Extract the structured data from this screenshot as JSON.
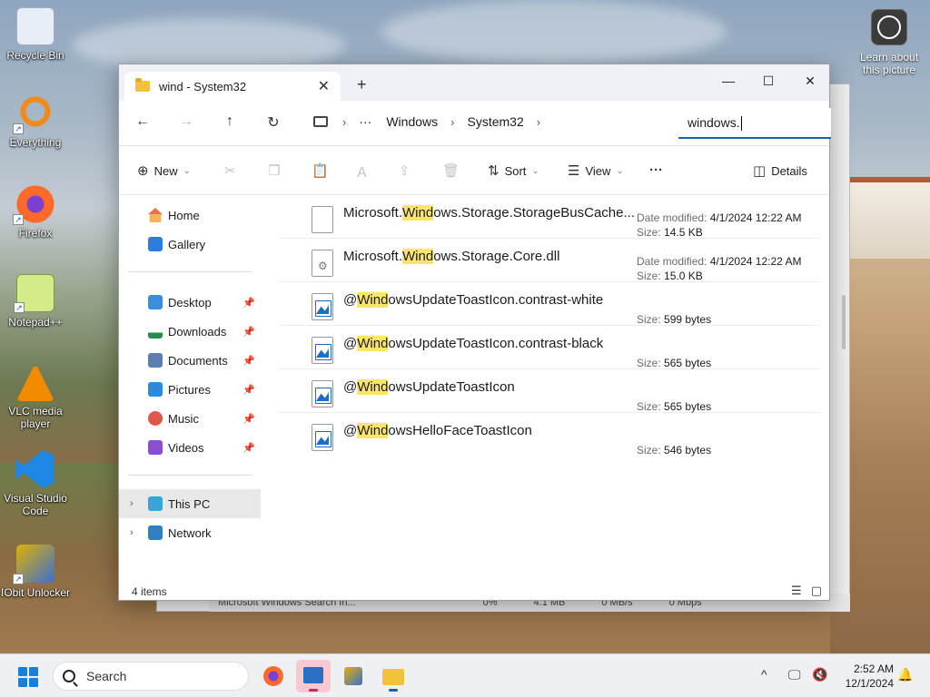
{
  "desktop": {
    "icons": [
      {
        "label": "Recycle Bin",
        "color": "#e8eef6"
      },
      {
        "label": "Everything",
        "color": "#f08a1c"
      },
      {
        "label": "Firefox",
        "color": "#ff6a2b"
      },
      {
        "label": "Notepad++",
        "color": "#d6ec8a"
      },
      {
        "label": "VLC media player",
        "color": "#f28b00"
      },
      {
        "label": "Visual Studio Code",
        "color": "#1e88e5"
      },
      {
        "label": "IObit Unlocker",
        "color": "#e2b100"
      }
    ],
    "learn_label": "Learn about this picture"
  },
  "background_window": {
    "row_text": "Microsoft Windows Search In...",
    "row_values": [
      "0%",
      "4.1 MB",
      "0 MB/s",
      "0 Mbps"
    ]
  },
  "window": {
    "tab_title": "wind - System32",
    "tab_close": "✕",
    "tab_add": "+",
    "minimize": "—",
    "maximize": "☐",
    "close": "✕"
  },
  "address": {
    "back": "←",
    "forward": "→",
    "up": "↑",
    "refresh": "↻",
    "more": "···",
    "crumbs": [
      "Windows",
      "System32"
    ],
    "sep": "›"
  },
  "search": {
    "value": "windows."
  },
  "toolbar": {
    "new_label": "New",
    "sort_label": "Sort",
    "view_label": "View",
    "more": "···",
    "details_label": "Details"
  },
  "sidebar": {
    "home": "Home",
    "gallery": "Gallery",
    "quick": [
      {
        "label": "Desktop"
      },
      {
        "label": "Downloads"
      },
      {
        "label": "Documents"
      },
      {
        "label": "Pictures"
      },
      {
        "label": "Music"
      },
      {
        "label": "Videos"
      }
    ],
    "this_pc": "This PC",
    "network": "Network"
  },
  "files": [
    {
      "prefix": "Microsoft.",
      "hl": "Wind",
      "rest": "ows.Storage.StorageBusCache...",
      "date_label": "Date modified:",
      "date": "4/1/2024 12:22 AM",
      "size_label": "Size:",
      "size": "14.5 KB",
      "icon": "generic"
    },
    {
      "prefix": "Microsoft.",
      "hl": "Wind",
      "rest": "ows.Storage.Core.dll",
      "date_label": "Date modified:",
      "date": "4/1/2024 12:22 AM",
      "size_label": "Size:",
      "size": "15.0 KB",
      "icon": "dll"
    },
    {
      "prefix": "@",
      "hl": "Wind",
      "rest": "owsUpdateToastIcon.contrast-white",
      "date_label": "",
      "date": "",
      "size_label": "Size:",
      "size": "599 bytes",
      "icon": "image"
    },
    {
      "prefix": "@",
      "hl": "Wind",
      "rest": "owsUpdateToastIcon.contrast-black",
      "date_label": "",
      "date": "",
      "size_label": "Size:",
      "size": "565 bytes",
      "icon": "image"
    },
    {
      "prefix": "@",
      "hl": "Wind",
      "rest": "owsUpdateToastIcon",
      "date_label": "",
      "date": "",
      "size_label": "Size:",
      "size": "565 bytes",
      "icon": "image"
    },
    {
      "prefix": "@",
      "hl": "Wind",
      "rest": "owsHelloFaceToastIcon",
      "date_label": "",
      "date": "",
      "size_label": "Size:",
      "size": "546 bytes",
      "icon": "image"
    }
  ],
  "status": {
    "count": "4 items"
  },
  "taskbar": {
    "search_label": "Search",
    "time": "2:52 AM",
    "date": "12/1/2024",
    "tray_chevron": "^",
    "bell": "🔔"
  },
  "colors": {
    "accent": "#1a5fb4",
    "highlight": "#fbe56b",
    "folder": "#f3c13a"
  }
}
